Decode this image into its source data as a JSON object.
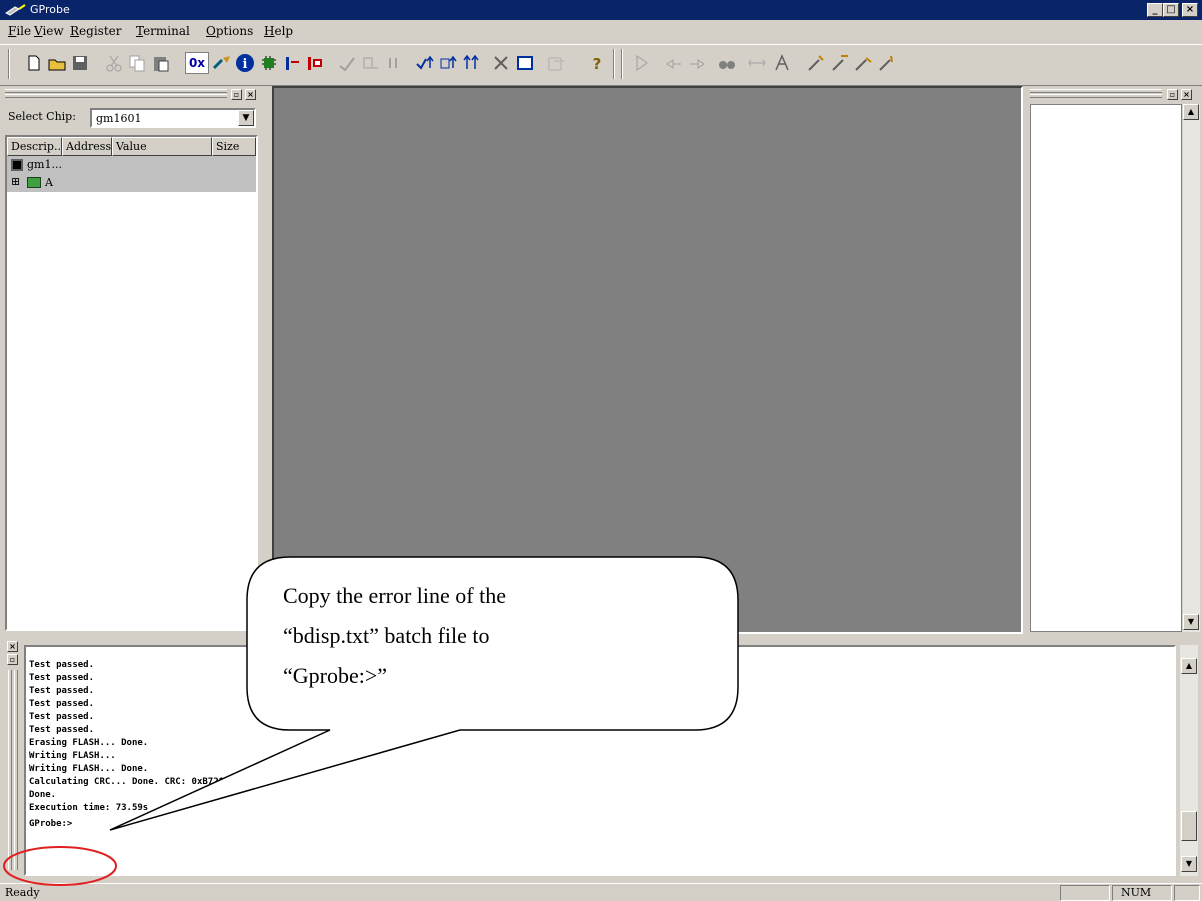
{
  "window": {
    "title": "GProbe",
    "minimize_label": "_",
    "maximize_label": "□",
    "close_label": "×"
  },
  "menu": [
    {
      "label": "File",
      "accel": "F",
      "rest": "ile"
    },
    {
      "label": "View",
      "accel": "V",
      "rest": "iew"
    },
    {
      "label": "Register",
      "accel": "R",
      "rest": "egister"
    },
    {
      "label": "Terminal",
      "accel": "T",
      "rest": "erminal"
    },
    {
      "label": "Options",
      "accel": "O",
      "rest": "ptions"
    },
    {
      "label": "Help",
      "accel": "H",
      "rest": "elp"
    }
  ],
  "toolbar": {
    "buttons": [
      "new-icon",
      "open-icon",
      "save-icon",
      "cut-icon",
      "copy-icon",
      "paste-icon",
      "hex-icon",
      "connect-icon",
      "info-icon",
      "chip-icon",
      "read-icon",
      "write-icon",
      "step-icon",
      "step-over-icon",
      "pause-icon",
      "check-icon",
      "verify-icon",
      "upload-icon",
      "cancel-icon",
      "window-icon",
      "disabled-icon",
      "help-icon",
      "run-icon",
      "undo-icon",
      "redo-icon",
      "find-icon",
      "replace-icon",
      "font-icon",
      "script1-icon",
      "script2-icon",
      "script3-icon",
      "script4-icon"
    ],
    "hex_label": "0x"
  },
  "left_panel": {
    "select_chip_label": "Select Chip:",
    "chip_value": "gm1601",
    "dropdown_arrow": "▼",
    "columns": [
      "Descrip...",
      "Address",
      "Value",
      "Size"
    ],
    "tree": [
      {
        "label": "gm1..."
      },
      {
        "expander": "⊞",
        "label": "A"
      }
    ]
  },
  "output": {
    "lines": [
      "Test passed.",
      "Test passed.",
      "Test passed.",
      "Test passed.",
      "Test passed.",
      "Test passed.",
      "Erasing FLASH... Done.",
      "Writing FLASH...",
      "Writing FLASH... Done.",
      "Calculating CRC... Done. CRC: 0xB728",
      "Done.",
      "Execution time: 73.59s",
      "GProbe:>"
    ]
  },
  "status": {
    "text": "Ready",
    "num": "NUM"
  },
  "callout": {
    "line1": "Copy the error line of the",
    "line2": "“bdisp.txt” batch file to",
    "line3": "“Gprobe:>”"
  },
  "colors": {
    "title_bar": "#0a246a",
    "face": "#d4d0c8",
    "mdi_background": "#808080",
    "highlight_circle": "#e02020"
  }
}
